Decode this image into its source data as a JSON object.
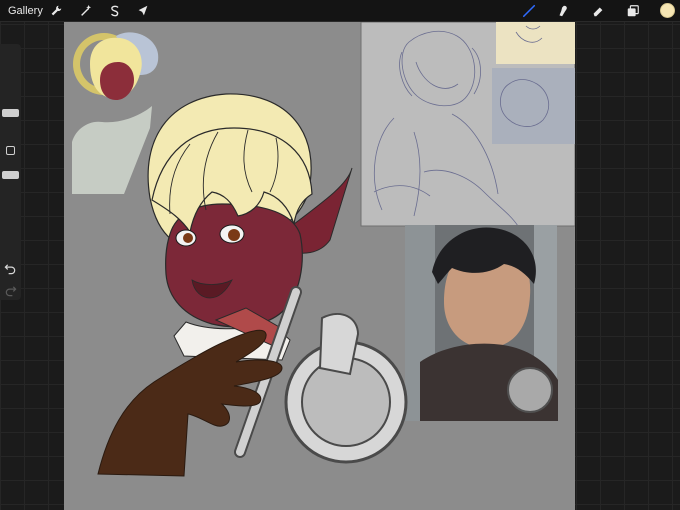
{
  "toolbar": {
    "gallery_label": "Gallery",
    "left_tools": [
      "wrench-icon",
      "magic-wand-icon",
      "selection-icon",
      "transform-arrow-icon"
    ],
    "right_tools": [
      "brush-icon",
      "smudge-icon",
      "eraser-icon",
      "layers-icon"
    ],
    "active_tool": "brush-icon",
    "current_color": "#f6e6b4",
    "accent_color": "#2f6bff"
  },
  "sidebar": {
    "brush_size_level": 0.68,
    "opacity_level": 0.42,
    "tools": [
      "modify-square-icon",
      "undo-icon",
      "redo-icon"
    ]
  },
  "canvas": {
    "background_color": "#8c8c8c",
    "layers": [
      "sketch-reference",
      "reference-photo",
      "color-sketch",
      "main-illustration"
    ]
  }
}
